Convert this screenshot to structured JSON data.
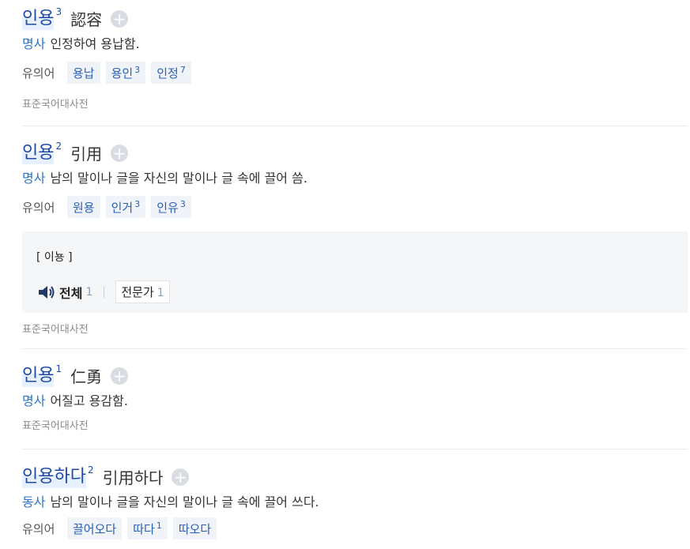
{
  "entries": [
    {
      "word": "인용",
      "sup": "3",
      "hanja": "認容",
      "add": "+",
      "pos": "명사",
      "definition": "인정하여 용납함.",
      "syn_label": "유의어",
      "synonyms": [
        {
          "text": "용납",
          "sup": ""
        },
        {
          "text": "용인",
          "sup": "3"
        },
        {
          "text": "인정",
          "sup": "7"
        }
      ],
      "source": "표준국어대사전"
    },
    {
      "word": "인용",
      "sup": "2",
      "hanja": "引用",
      "add": "+",
      "pos": "명사",
      "definition": "남의 말이나 글을 자신의 말이나 글 속에 끌어 씀.",
      "syn_label": "유의어",
      "synonyms": [
        {
          "text": "원용",
          "sup": ""
        },
        {
          "text": "인거",
          "sup": "3"
        },
        {
          "text": "인유",
          "sup": "3"
        }
      ],
      "pronunciation": "[ 이뇽 ]",
      "pron_tabs": {
        "all_label": "전체",
        "all_count": "1",
        "expert_label": "전문가",
        "expert_count": "1"
      },
      "source": "표준국어대사전"
    },
    {
      "word": "인용",
      "sup": "1",
      "hanja": "仁勇",
      "add": "+",
      "pos": "명사",
      "definition": "어질고 용감함.",
      "source": "표준국어대사전"
    },
    {
      "word": "인용하다",
      "sup": "2",
      "hanja": "引用하다",
      "add": "+",
      "pos": "동사",
      "definition": "남의 말이나 글을 자신의 말이나 글 속에 끌어 쓰다.",
      "syn_label": "유의어",
      "synonyms": [
        {
          "text": "끌어오다",
          "sup": ""
        },
        {
          "text": "따다",
          "sup": "1"
        },
        {
          "text": "따오다",
          "sup": ""
        }
      ]
    }
  ],
  "icons": {
    "speaker": "speaker-icon",
    "add": "plus-circle-icon"
  },
  "colors": {
    "headword": "#1f4aa8",
    "pos": "#2a74c9",
    "chip_bg": "#f0f3f8"
  }
}
